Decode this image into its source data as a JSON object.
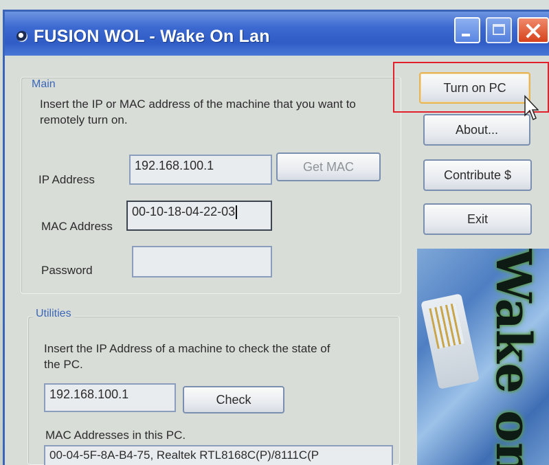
{
  "window": {
    "title": "FUSION WOL - Wake On Lan"
  },
  "main": {
    "legend": "Main",
    "description": "Insert the IP or MAC address of the machine that you want to remotely turn on.",
    "ip_label": "IP Address",
    "ip_value": "192.168.100.1",
    "get_mac_label": "Get MAC",
    "mac_label": "MAC Address",
    "mac_value": "00-10-18-04-22-03",
    "password_label": "Password",
    "password_value": ""
  },
  "utilities": {
    "legend": "Utilities",
    "description": "Insert the IP Address of a machine to check the state of the PC.",
    "check_ip_value": "192.168.100.1",
    "check_label": "Check",
    "mac_list_label": "MAC Addresses in this PC.",
    "mac_list_value": "00-04-5F-8A-B4-75, Realtek RTL8168C(P)/8111C(P"
  },
  "side_buttons": {
    "turn_on_label": "Turn on PC",
    "about_label": "About...",
    "contribute_label": "Contribute $",
    "exit_label": "Exit"
  },
  "banner": {
    "text": "Wake on LAN"
  },
  "icons": {
    "app": "app-icon",
    "minimize": "minimize-icon",
    "maximize": "maximize-icon",
    "close": "close-icon",
    "cursor": "mouse-pointer-icon"
  },
  "colors": {
    "titlebar": "#2f5cc5",
    "highlight": "#e0202a",
    "legend": "#3b66b8",
    "default_button_border": "#e7b657"
  }
}
